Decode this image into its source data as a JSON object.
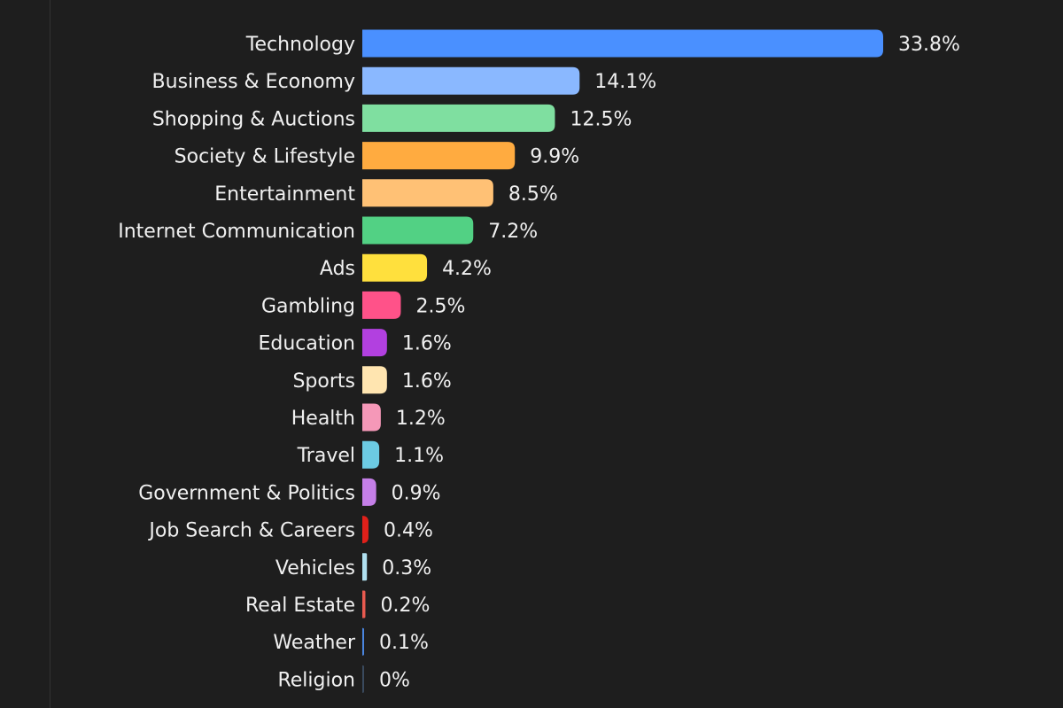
{
  "chart_data": {
    "type": "bar",
    "orientation": "horizontal",
    "title": "",
    "xlabel": "",
    "ylabel": "",
    "value_suffix": "%",
    "grid": false,
    "legend": "none",
    "categories": [
      "Technology",
      "Business & Economy",
      "Shopping & Auctions",
      "Society & Lifestyle",
      "Entertainment",
      "Internet Communication",
      "Ads",
      "Gambling",
      "Education",
      "Sports",
      "Health",
      "Travel",
      "Government & Politics",
      "Job Search & Careers",
      "Vehicles",
      "Real Estate",
      "Weather",
      "Religion"
    ],
    "values": [
      33.8,
      14.1,
      12.5,
      9.9,
      8.5,
      7.2,
      4.2,
      2.5,
      1.6,
      1.6,
      1.2,
      1.1,
      0.9,
      0.4,
      0.3,
      0.2,
      0.1,
      0
    ],
    "value_labels": [
      "33.8%",
      "14.1%",
      "12.5%",
      "9.9%",
      "8.5%",
      "7.2%",
      "4.2%",
      "2.5%",
      "1.6%",
      "1.6%",
      "1.2%",
      "1.1%",
      "0.9%",
      "0.4%",
      "0.3%",
      "0.2%",
      "0.1%",
      "0%"
    ],
    "colors": [
      "#4a90ff",
      "#8ab8ff",
      "#7fdfa0",
      "#ffab40",
      "#ffc175",
      "#52d184",
      "#ffe03d",
      "#ff5289",
      "#b240e0",
      "#ffe5b0",
      "#f598b8",
      "#6ccbe3",
      "#c57fe8",
      "#e0201a",
      "#b0e0f0",
      "#e85a4f",
      "#4a86e0",
      "#3a4a5e"
    ],
    "xlim": [
      0,
      33.8
    ]
  }
}
